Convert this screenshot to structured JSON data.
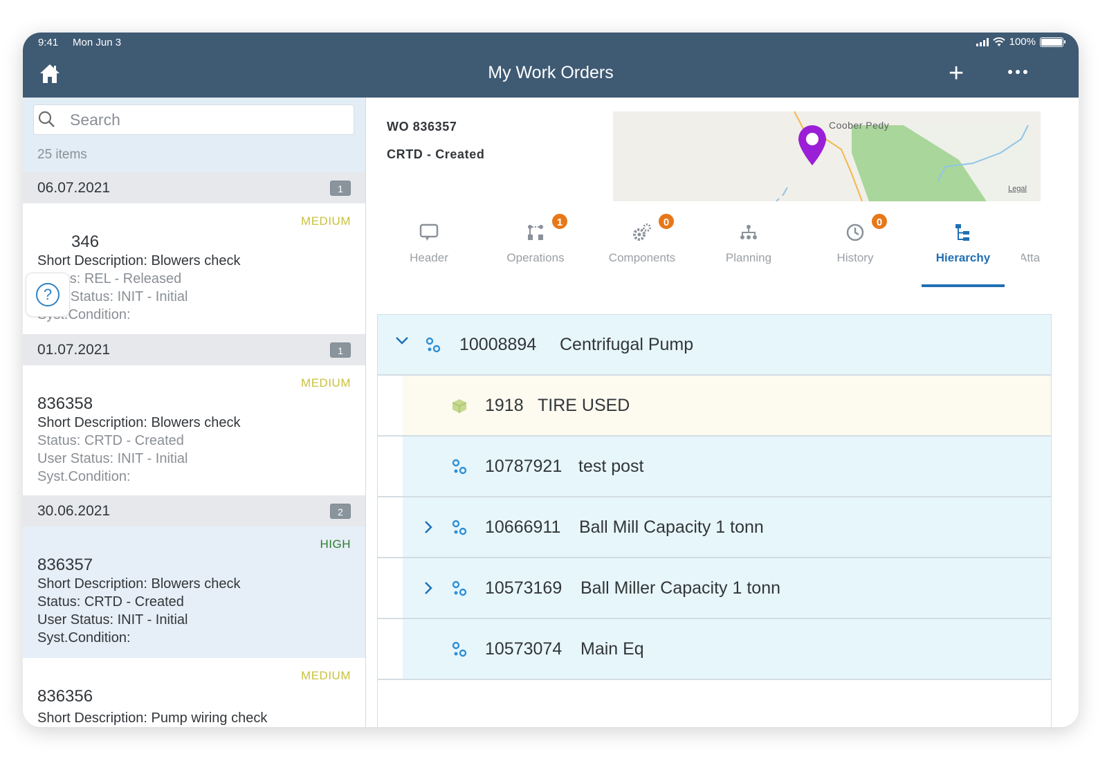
{
  "status_bar": {
    "time": "9:41",
    "date": "Mon Jun 3",
    "battery": "100%"
  },
  "nav": {
    "title": "My Work Orders",
    "home_icon": "home-icon",
    "add_icon": "plus-icon",
    "more_icon": "more-icon"
  },
  "search": {
    "placeholder": "Search",
    "count": "25 items"
  },
  "groups": [
    {
      "date": "06.07.2021",
      "count": "1"
    },
    {
      "date": "01.07.2021",
      "count": "1"
    },
    {
      "date": "30.06.2021",
      "count": "2"
    }
  ],
  "orders": [
    {
      "priority": "MEDIUM",
      "number": "346",
      "desc": "Short Description: Blowers check",
      "status": "Status: REL - Released",
      "user_status": "User Status: INIT - Initial",
      "syst": "Syst.Condition:"
    },
    {
      "priority": "MEDIUM",
      "number": "836358",
      "desc": "Short Description: Blowers check",
      "status": "Status: CRTD - Created",
      "user_status": "User Status: INIT - Initial",
      "syst": "Syst.Condition:"
    },
    {
      "priority": "HIGH",
      "number": "836357",
      "desc": "Short Description: Blowers check",
      "status": "Status: CRTD - Created",
      "user_status": "User Status: INIT - Initial",
      "syst": "Syst.Condition:"
    },
    {
      "priority": "MEDIUM",
      "number": "836356",
      "desc": "Short Description: Pump wiring check"
    }
  ],
  "detail": {
    "wo": "WO 836357",
    "status": "CRTD - Created",
    "map": {
      "place": "Coober Pedy",
      "legal": "Legal"
    }
  },
  "tabs": [
    {
      "label": "Header",
      "icon": "comment-icon",
      "count": null
    },
    {
      "label": "Operations",
      "icon": "operations-icon",
      "count": "1"
    },
    {
      "label": "Components",
      "icon": "gears-icon",
      "count": "0"
    },
    {
      "label": "Planning",
      "icon": "planning-icon",
      "count": null
    },
    {
      "label": "History",
      "icon": "history-icon",
      "count": "0"
    },
    {
      "label": "Hierarchy",
      "icon": "hierarchy-icon",
      "count": null,
      "active": true
    },
    {
      "label": "Atta",
      "icon": "attachment-icon",
      "count": null
    }
  ],
  "hierarchy": [
    {
      "id": "10008894",
      "name": "Centrifugal Pump",
      "expanded": true,
      "kind": "equipment"
    },
    {
      "id": "1918",
      "name": "TIRE USED",
      "kind": "material"
    },
    {
      "id": "10787921",
      "name": "test post",
      "kind": "equipment"
    },
    {
      "id": "10666911",
      "name": "Ball Mill Capacity 1 tonn",
      "collapsed": true,
      "kind": "equipment"
    },
    {
      "id": "10573169",
      "name": "Ball Miller Capacity 1 tonn",
      "collapsed": true,
      "kind": "equipment"
    },
    {
      "id": "10573074",
      "name": "Main Eq",
      "kind": "equipment"
    }
  ],
  "colors": {
    "bar": "#3f5a73",
    "accent": "#1f6fb5",
    "badge": "#e7781a",
    "high": "#2b7c2b",
    "medium": "#c9c23d"
  }
}
